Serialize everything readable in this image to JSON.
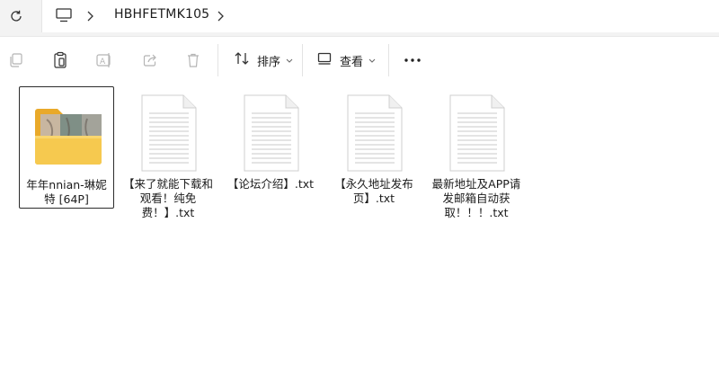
{
  "address_bar": {
    "refresh_icon": "refresh-icon",
    "location_icon": "this-pc-icon",
    "breadcrumb": [
      "HBHFETMK105"
    ]
  },
  "toolbar": {
    "icons": [
      "copy-icon",
      "paste-icon",
      "rename-icon",
      "share-icon",
      "delete-icon"
    ],
    "sort_label": "排序",
    "view_label": "查看",
    "more_icon": "more-icon"
  },
  "files": [
    {
      "name": "年年nnian-琳妮特 [64P]",
      "type": "folder",
      "selected": true
    },
    {
      "name": "【来了就能下载和观看！纯免费！】.txt",
      "type": "txt",
      "selected": false
    },
    {
      "name": "【论坛介绍】.txt",
      "type": "txt",
      "selected": false
    },
    {
      "name": "【永久地址发布页】.txt",
      "type": "txt",
      "selected": false
    },
    {
      "name": "最新地址及APP请发邮箱自动获取！！！.txt",
      "type": "txt",
      "selected": false
    }
  ],
  "colors": {
    "folder": "#f2c14b",
    "folder_back": "#e9a92a",
    "accent": "#0067c0"
  }
}
